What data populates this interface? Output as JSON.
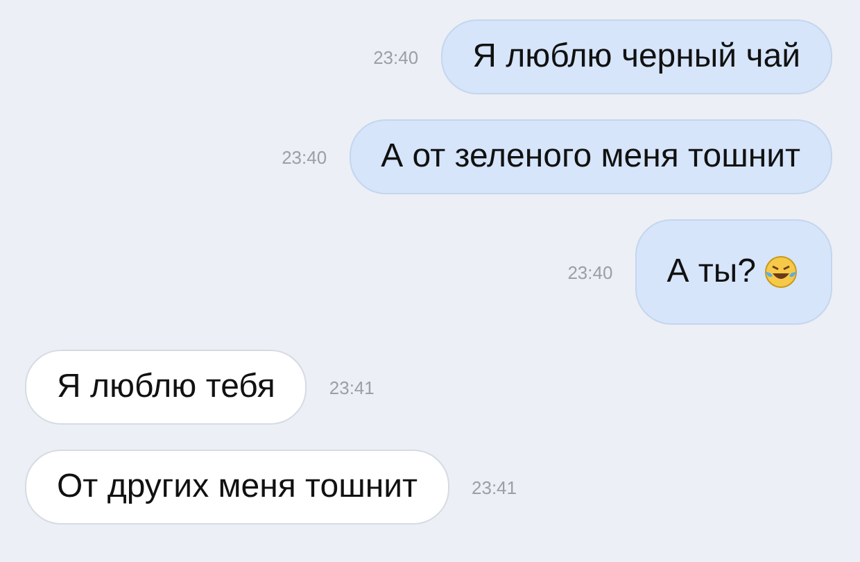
{
  "messages": [
    {
      "kind": "outgoing",
      "text": "Я люблю черный чай",
      "time": "23:40",
      "emoji": false
    },
    {
      "kind": "outgoing",
      "text": "А от зеленого меня тошнит",
      "time": "23:40",
      "emoji": false
    },
    {
      "kind": "outgoing",
      "text": "А ты?",
      "time": "23:40",
      "emoji": true
    },
    {
      "kind": "incoming",
      "text": "Я люблю тебя",
      "time": "23:41",
      "emoji": false
    },
    {
      "kind": "incoming",
      "text": "От других меня тошнит",
      "time": "23:41",
      "emoji": false
    }
  ]
}
